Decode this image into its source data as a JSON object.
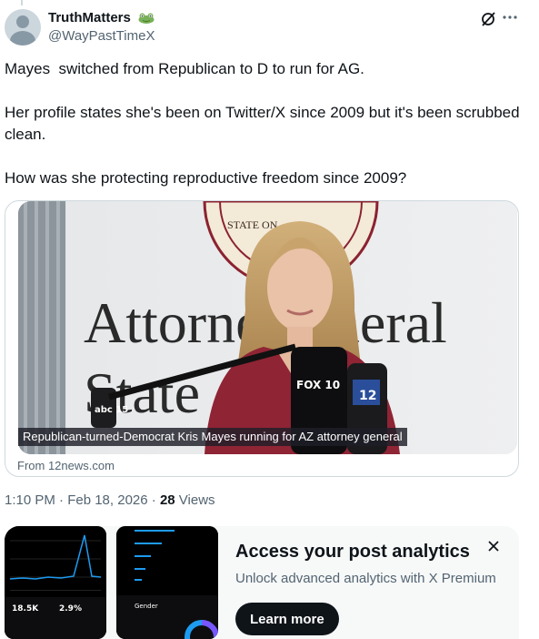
{
  "author": {
    "display_name": "TruthMatters",
    "handle": "@WayPastTimeX",
    "badge_icon": "frog-emoji-icon"
  },
  "header_actions": {
    "grok_icon": "grok-icon",
    "more_icon": "more-horizontal-icon"
  },
  "tweet": {
    "paragraphs": [
      "Mayes  switched from Republican to D to run for AG.",
      "Her profile states she's been on Twitter/X since 2009 but it's been scrubbed clean.",
      "How was she protecting reproductive freedom since 2009?"
    ]
  },
  "media": {
    "caption": "Republican-turned-Democrat Kris Mayes running for AZ attorney general",
    "source": "From 12news.com",
    "sign_line1": "Attorne   eneral",
    "sign_line2": "State       ona",
    "seal_text": "STATE     ON",
    "mic_labels": [
      "abc 15",
      "FOX 10",
      "12"
    ]
  },
  "meta": {
    "timestamp": "1:10 PM · Feb 18, 2026 · ",
    "views_count": "28",
    "views_label": " Views"
  },
  "promo": {
    "title": "Access your post analytics",
    "subtitle": "Unlock advanced analytics with X Premium",
    "button_label": "Learn more",
    "close_icon": "close-icon",
    "phone_left": {
      "stat1": "18.5K",
      "stat2": "2.9%"
    },
    "phone_right": {
      "section": "Gender"
    }
  },
  "colors": {
    "text_primary": "#0f1419",
    "text_secondary": "#536471",
    "border": "#cfd9de",
    "promo_bg": "#f7f9f9",
    "frog_green": "#78b159"
  }
}
